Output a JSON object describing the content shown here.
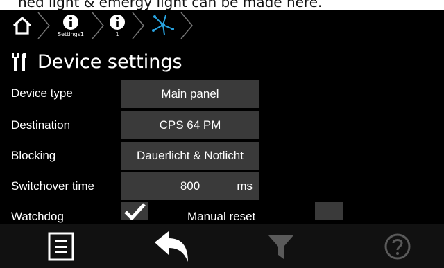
{
  "caption": "ned light & emergy light can be made here.",
  "breadcrumb": [
    {
      "icon": "home-icon"
    },
    {
      "icon": "info-icon",
      "label": "Settings1"
    },
    {
      "icon": "info-icon",
      "label": "1"
    },
    {
      "icon": "network-icon"
    }
  ],
  "page_title": "Device settings",
  "rows": {
    "device_type": {
      "label": "Device type",
      "value": "Main panel"
    },
    "destination": {
      "label": "Destination",
      "value": "CPS 64 PM"
    },
    "blocking": {
      "label": "Blocking",
      "value": "Dauerlicht & Notlicht"
    },
    "switchover": {
      "label": "Switchover time",
      "value": "800",
      "unit": "ms"
    },
    "watchdog": {
      "label": "Watchdog",
      "checked": true
    },
    "manual_reset": {
      "label": "Manual reset",
      "checked": false
    }
  },
  "toolbar": [
    "menu-icon",
    "back-arrow-icon",
    "filter-icon",
    "help-icon"
  ],
  "colors": {
    "background": "#000000",
    "field": "#3a3a3a",
    "text": "#ffffff",
    "disabled": "#5a5a5a"
  }
}
